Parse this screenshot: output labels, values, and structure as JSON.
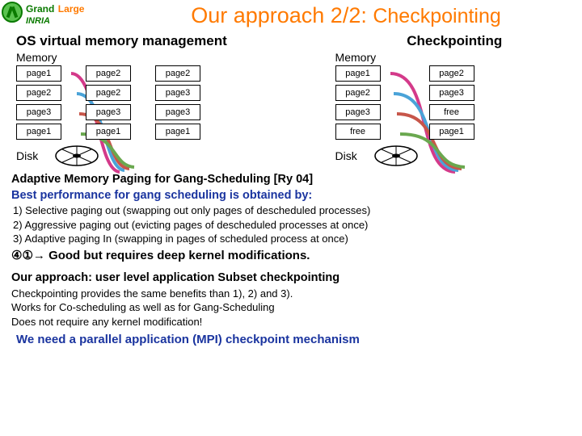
{
  "logo": {
    "grand": "Grand",
    "large": "Large",
    "inria": "INRIA"
  },
  "title_main": "Our approach 2/2: ",
  "title_sub": "Checkpointing",
  "left": {
    "heading": "OS virtual memory management",
    "memory": "Memory",
    "rows": [
      [
        "page1",
        "page2",
        "page2"
      ],
      [
        "page2",
        "page2",
        "page3"
      ],
      [
        "page3",
        "page3",
        "page3"
      ],
      [
        "page1",
        "page1",
        "page1"
      ]
    ],
    "disk": "Disk"
  },
  "right": {
    "heading": "Checkpointing",
    "memory": "Memory",
    "rows": [
      [
        "page1",
        "page2"
      ],
      [
        "page2",
        "page3"
      ],
      [
        "page3",
        "free"
      ],
      [
        "free",
        "page1"
      ]
    ],
    "disk": "Disk"
  },
  "ry_title": "Adaptive Memory Paging for Gang-Scheduling [Ry 04]",
  "best_line": "Best performance for gang scheduling is obtained by:",
  "items": [
    "1)    Selective paging out (swapping out only pages of descheduled processes)",
    "2)    Aggressive paging out (evicting pages of descheduled processes at once)",
    "3)    Adaptive paging In (swapping in pages of scheduled process at once)"
  ],
  "arrow_prefix": "④①→ ",
  "arrow_text": "Good but requires deep kernel modifications.",
  "our_heading": "Our approach: user level application Subset checkpointing",
  "our_lines": [
    "Checkpointing provides the same benefits than 1), 2) and 3).",
    "Works for Co-scheduling as well as for Gang-Scheduling",
    "Does not require any kernel modification!"
  ],
  "need": "We need a parallel application (MPI) checkpoint mechanism"
}
